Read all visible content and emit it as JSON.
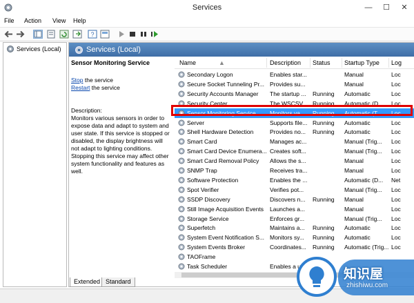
{
  "window": {
    "title": "Services",
    "minimize": "—",
    "maximize": "☐",
    "close": "✕"
  },
  "menu": [
    "File",
    "Action",
    "View",
    "Help"
  ],
  "tree": {
    "root_label": "Services (Local)"
  },
  "pane": {
    "header_title": "Services (Local)",
    "service_name": "Sensor Monitoring Service",
    "stop_link": "Stop",
    "stop_suffix": " the service",
    "restart_link": "Restart",
    "restart_suffix": " the service",
    "desc_title": "Description:",
    "desc_body": "Monitors various sensors in order to expose data and adapt to system and user state.  If this service is stopped or disabled, the display brightness will not adapt to lighting conditions. Stopping this service may affect other system functionality and features as well."
  },
  "columns": [
    "Name",
    "Description",
    "Status",
    "Startup Type",
    "Log"
  ],
  "rows": [
    {
      "name": "Secondary Logon",
      "desc": "Enables star...",
      "status": "",
      "type": "Manual",
      "log": "Loc"
    },
    {
      "name": "Secure Socket Tunneling Pr...",
      "desc": "Provides su...",
      "status": "",
      "type": "Manual",
      "log": "Loc"
    },
    {
      "name": "Security Accounts Manager",
      "desc": "The startup ...",
      "status": "Running",
      "type": "Automatic",
      "log": "Loc"
    },
    {
      "name": "Security Center",
      "desc": "The WSCSV...",
      "status": "Running",
      "type": "Automatic (D...",
      "log": "Loc"
    },
    {
      "name": "Sensor Monitoring Service",
      "desc": "Monitors va...",
      "status": "Running",
      "type": "Automatic (T...",
      "log": "Loc",
      "selected": true
    },
    {
      "name": "Server",
      "desc": "Supports file...",
      "status": "Running",
      "type": "Automatic",
      "log": "Loc"
    },
    {
      "name": "Shell Hardware Detection",
      "desc": "Provides no...",
      "status": "Running",
      "type": "Automatic",
      "log": "Loc"
    },
    {
      "name": "Smart Card",
      "desc": "Manages ac...",
      "status": "",
      "type": "Manual (Trig...",
      "log": "Loc"
    },
    {
      "name": "Smart Card Device Enumera...",
      "desc": "Creates soft...",
      "status": "",
      "type": "Manual (Trig...",
      "log": "Loc"
    },
    {
      "name": "Smart Card Removal Policy",
      "desc": "Allows the s...",
      "status": "",
      "type": "Manual",
      "log": "Loc"
    },
    {
      "name": "SNMP Trap",
      "desc": "Receives tra...",
      "status": "",
      "type": "Manual",
      "log": "Loc"
    },
    {
      "name": "Software Protection",
      "desc": "Enables the ...",
      "status": "",
      "type": "Automatic (D...",
      "log": "Net"
    },
    {
      "name": "Spot Verifier",
      "desc": "Verifies pot...",
      "status": "",
      "type": "Manual (Trig...",
      "log": "Loc"
    },
    {
      "name": "SSDP Discovery",
      "desc": "Discovers n...",
      "status": "Running",
      "type": "Manual",
      "log": "Loc"
    },
    {
      "name": "Still Image Acquisition Events",
      "desc": "Launches a...",
      "status": "",
      "type": "Manual",
      "log": "Loc"
    },
    {
      "name": "Storage Service",
      "desc": "Enforces gr...",
      "status": "",
      "type": "Manual (Trig...",
      "log": "Loc"
    },
    {
      "name": "Superfetch",
      "desc": "Maintains a...",
      "status": "Running",
      "type": "Automatic",
      "log": "Loc"
    },
    {
      "name": "System Event Notification S...",
      "desc": "Monitors sy...",
      "status": "Running",
      "type": "Automatic",
      "log": "Loc"
    },
    {
      "name": "System Events Broker",
      "desc": "Coordinates...",
      "status": "Running",
      "type": "Automatic (Trig...",
      "log": "Loc"
    },
    {
      "name": "TAOFrame",
      "desc": "",
      "status": "",
      "type": "",
      "log": ""
    },
    {
      "name": "Task Scheduler",
      "desc": "Enables a u...",
      "status": "",
      "type": "",
      "log": ""
    }
  ],
  "tabs": [
    "Extended",
    "Standard"
  ],
  "watermark": {
    "text": "知识屋",
    "sub": "zhishiwu.com"
  }
}
